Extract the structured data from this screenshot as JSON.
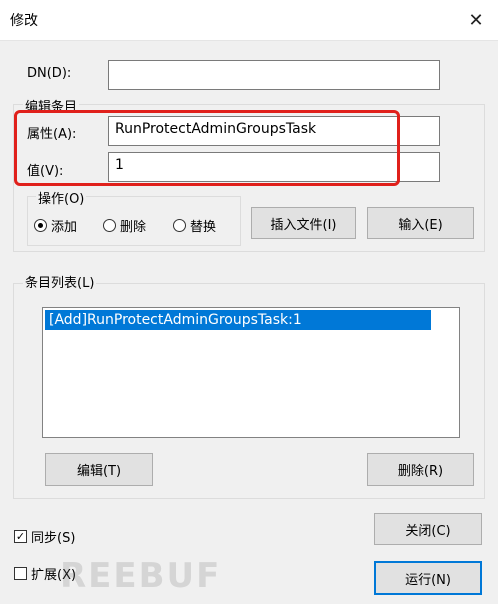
{
  "window": {
    "title": "修改",
    "close_glyph": "✕"
  },
  "dn": {
    "label": "DN(D):",
    "value": ""
  },
  "edit_entry": {
    "group_title": "编辑条目",
    "attribute_label": "属性(A):",
    "attribute_value": "RunProtectAdminGroupsTask",
    "value_label": "值(V):",
    "value_value": "1",
    "operation": {
      "group_title": "操作(O)",
      "options": [
        "添加",
        "删除",
        "替换"
      ],
      "selected": "添加"
    },
    "insert_file_button": "插入文件(I)",
    "enter_button": "输入(E)"
  },
  "entry_list": {
    "group_title": "条目列表(L)",
    "items": [
      "[Add]RunProtectAdminGroupsTask:1"
    ],
    "edit_button": "编辑(T)",
    "delete_button": "删除(R)"
  },
  "options": {
    "sync_label": "同步(S)",
    "sync_checked": true,
    "extended_label": "扩展(X)",
    "extended_checked": false
  },
  "footer": {
    "close_button": "关闭(C)",
    "run_button": "运行(N)"
  },
  "watermark": "REEBUF",
  "colors": {
    "selection": "#0078d7",
    "highlight_annotation": "#e0201b",
    "default_button_border": "#0078d7"
  }
}
